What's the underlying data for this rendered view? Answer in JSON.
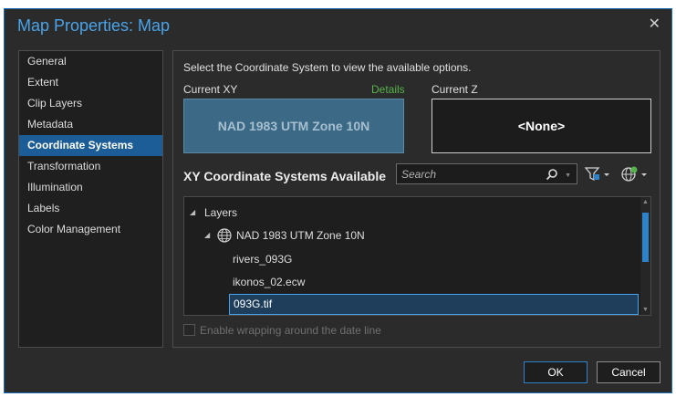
{
  "window": {
    "title": "Map Properties: Map",
    "close_glyph": "✕"
  },
  "nav": {
    "items": [
      {
        "label": "General"
      },
      {
        "label": "Extent"
      },
      {
        "label": "Clip Layers"
      },
      {
        "label": "Metadata"
      },
      {
        "label": "Coordinate Systems",
        "selected": true
      },
      {
        "label": "Transformation"
      },
      {
        "label": "Illumination"
      },
      {
        "label": "Labels"
      },
      {
        "label": "Color Management"
      }
    ]
  },
  "content": {
    "instruction": "Select the Coordinate System to view the available options.",
    "current_xy_label": "Current XY",
    "details_link": "Details",
    "current_z_label": "Current Z",
    "current_xy_value": "NAD 1983 UTM Zone 10N",
    "current_z_value": "<None>",
    "available_heading": "XY Coordinate Systems Available",
    "search": {
      "placeholder": "Search"
    },
    "tree": {
      "root": "Layers",
      "crs": "NAD 1983 UTM Zone 10N",
      "layers": [
        "rivers_093G",
        "ikonos_02.ecw",
        "093G.tif"
      ],
      "selected_layer": "093G.tif"
    },
    "wrap_option": "Enable wrapping around the date line"
  },
  "buttons": {
    "ok": "OK",
    "cancel": "Cancel"
  },
  "colors": {
    "accent": "#2e82c8",
    "title": "#4aa3e8",
    "details_link": "#56b34a",
    "selected_nav": "#1c5d97"
  },
  "icons": [
    "close-icon",
    "search-icon",
    "filter-icon",
    "globe-add-icon",
    "globe-icon",
    "expand-triangle-icon"
  ]
}
